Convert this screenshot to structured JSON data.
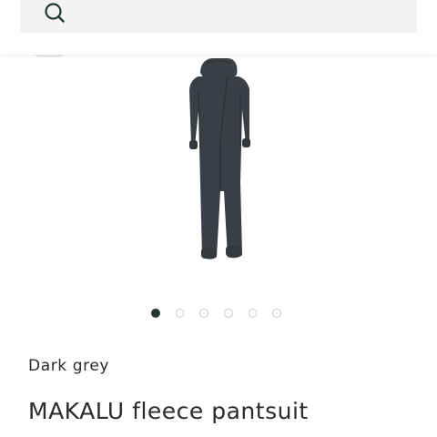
{
  "header": {
    "search_icon": "search-icon"
  },
  "gallery": {
    "image_subject": "dark grey fleece pantsuit",
    "slide_count": 6,
    "active_slide": 1
  },
  "product": {
    "color": "Dark grey",
    "title": "MAKALU fleece pantsuit"
  },
  "colors": {
    "accent": "#223b30",
    "garment": "#3a3f45",
    "search_bg": "#f3f3f3",
    "text": "#2b2b2b"
  }
}
